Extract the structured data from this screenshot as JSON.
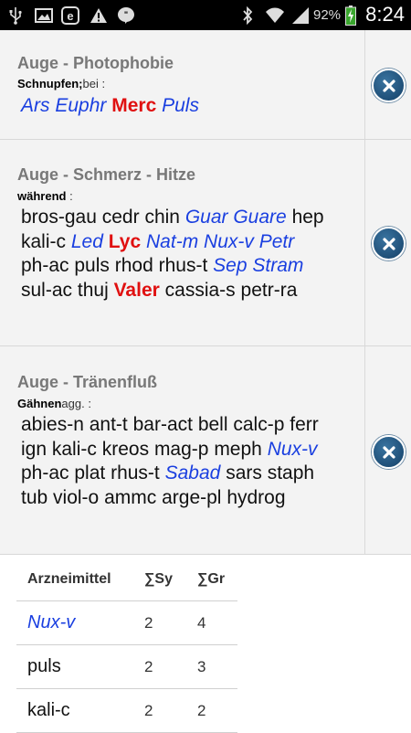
{
  "status_bar": {
    "battery_percent": "92%",
    "time": "8:24",
    "icons": [
      "usb-icon",
      "gallery-icon",
      "browser-icon",
      "warning-icon",
      "chat-icon",
      "bluetooth-icon",
      "wifi-icon",
      "signal-icon",
      "battery-icon"
    ]
  },
  "rubrics": [
    {
      "title": "Auge - Photophobie",
      "sub_bold": "Schnupfen;",
      "sub_rest": "bei :",
      "remedies": [
        {
          "name": "Ars",
          "grade": 2
        },
        {
          "name": "Euphr",
          "grade": 2
        },
        {
          "name": "Merc",
          "grade": 3
        },
        {
          "name": "Puls",
          "grade": 2
        }
      ]
    },
    {
      "title": "Auge - Schmerz - Hitze",
      "sub_bold": "während",
      "sub_rest": " :",
      "remedies": [
        {
          "name": "bros-gau",
          "grade": 1
        },
        {
          "name": "cedr",
          "grade": 1
        },
        {
          "name": "chin",
          "grade": 1
        },
        {
          "name": "Guar",
          "grade": 2
        },
        {
          "name": "Guare",
          "grade": 2
        },
        {
          "name": "hep",
          "grade": 1
        },
        {
          "name": "kali-c",
          "grade": 1
        },
        {
          "name": "Led",
          "grade": 2
        },
        {
          "name": "Lyc",
          "grade": 3
        },
        {
          "name": "Nat-m",
          "grade": 2
        },
        {
          "name": "Nux-v",
          "grade": 2
        },
        {
          "name": "Petr",
          "grade": 2
        },
        {
          "name": "ph-ac",
          "grade": 1
        },
        {
          "name": "puls",
          "grade": 1
        },
        {
          "name": "rhod",
          "grade": 1
        },
        {
          "name": "rhus-t",
          "grade": 1
        },
        {
          "name": "Sep",
          "grade": 2
        },
        {
          "name": "Stram",
          "grade": 2
        },
        {
          "name": "sul-ac",
          "grade": 1
        },
        {
          "name": "thuj",
          "grade": 1
        },
        {
          "name": "Valer",
          "grade": 3
        },
        {
          "name": "cassia-s",
          "grade": 1
        },
        {
          "name": "petr-ra",
          "grade": 1
        }
      ]
    },
    {
      "title": "Auge - Tränenfluß",
      "sub_bold": "Gähnen",
      "sub_rest": "agg. :",
      "remedies": [
        {
          "name": "abies-n",
          "grade": 1
        },
        {
          "name": "ant-t",
          "grade": 1
        },
        {
          "name": "bar-act",
          "grade": 1
        },
        {
          "name": "bell",
          "grade": 1
        },
        {
          "name": "calc-p",
          "grade": 1
        },
        {
          "name": "ferr",
          "grade": 1
        },
        {
          "name": "ign",
          "grade": 1
        },
        {
          "name": "kali-c",
          "grade": 1
        },
        {
          "name": "kreos",
          "grade": 1
        },
        {
          "name": "mag-p",
          "grade": 1
        },
        {
          "name": "meph",
          "grade": 1
        },
        {
          "name": "Nux-v",
          "grade": 2
        },
        {
          "name": "ph-ac",
          "grade": 1
        },
        {
          "name": "plat",
          "grade": 1
        },
        {
          "name": "rhus-t",
          "grade": 1
        },
        {
          "name": "Sabad",
          "grade": 2
        },
        {
          "name": "sars",
          "grade": 1
        },
        {
          "name": "staph",
          "grade": 1
        },
        {
          "name": "tub",
          "grade": 1
        },
        {
          "name": "viol-o",
          "grade": 1
        },
        {
          "name": "ammc",
          "grade": 1
        },
        {
          "name": "arge-pl",
          "grade": 1
        },
        {
          "name": "hydrog",
          "grade": 1
        }
      ]
    }
  ],
  "results_table": {
    "headers": [
      "Arzneimittel",
      "∑Sy",
      "∑Gr"
    ],
    "rows": [
      {
        "remedy": "Nux-v",
        "grade": 2,
        "sy": "2",
        "gr": "4"
      },
      {
        "remedy": "puls",
        "grade": 1,
        "sy": "2",
        "gr": "3"
      },
      {
        "remedy": "kali-c",
        "grade": 1,
        "sy": "2",
        "gr": "2"
      }
    ]
  },
  "colors": {
    "grade1": "#111111",
    "grade2": "#1a3fe0",
    "grade3": "#e01010",
    "card_bg": "#f3f3f3",
    "close_button": "#1f4f78"
  }
}
